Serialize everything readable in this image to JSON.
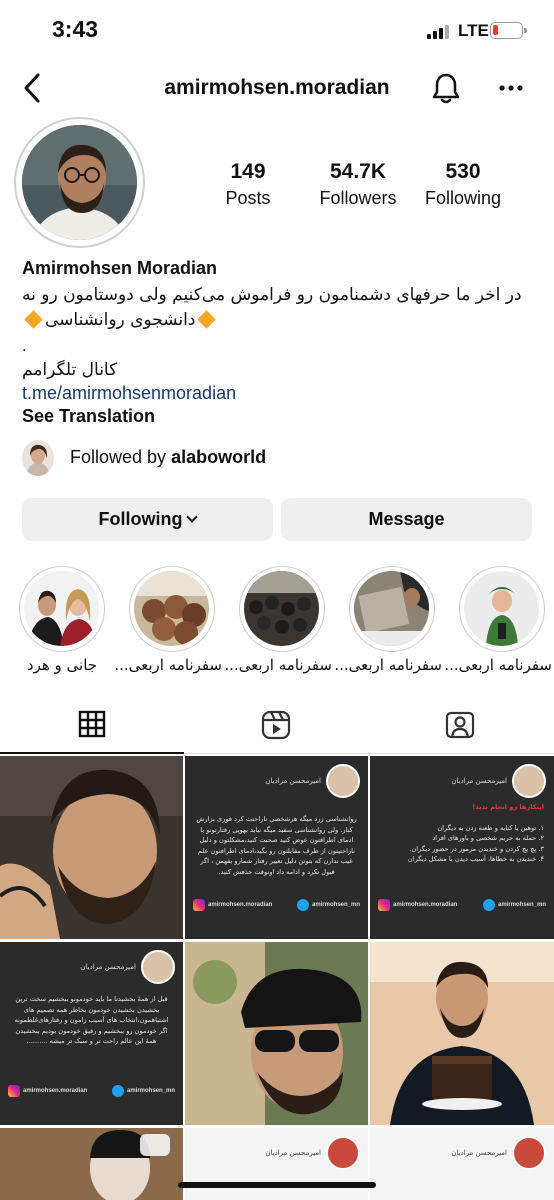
{
  "status_bar": {
    "time": "3:43",
    "network": "LTE"
  },
  "header": {
    "username": "amirmohsen.moradian"
  },
  "profile": {
    "stats": [
      {
        "value": "149",
        "label": "Posts"
      },
      {
        "value": "54.7K",
        "label": "Followers"
      },
      {
        "value": "530",
        "label": "Following"
      }
    ],
    "name": "Amirmohsen Moradian",
    "bio_line1": "در اخر ما حرفهای دشمنامون رو فراموش می‌کنیم ولی دوستامون رو نه",
    "bio_line2": "دانشجوی روانشناسی",
    "bio_line3": ".",
    "bio_line4": "کانال تلگرامم",
    "link": "t.me/amirmohsenmoradian",
    "see_translation": "See Translation",
    "followed_by_prefix": "Followed by",
    "followed_by_user": "alaboworld"
  },
  "actions": {
    "following": "Following",
    "message": "Message"
  },
  "highlights": [
    {
      "label": "جانی و هرد"
    },
    {
      "label": "سفرنامه اربعی..."
    },
    {
      "label": "سفرنامه اربعی..."
    },
    {
      "label": "سفرنامه اربعی..."
    },
    {
      "label": "سفرنامه اربعی..."
    }
  ],
  "tabs": [
    {
      "icon": "grid-icon"
    },
    {
      "icon": "reels-icon"
    },
    {
      "icon": "tagged-icon"
    }
  ],
  "posts": {
    "author_name": "امیرمحسن مرادیان",
    "instagram_handle": "amirmohsen.moradian",
    "twitter_handle": "amirmohsen_mn",
    "post2_text": "روانشناسی زرد میگه هرشخصی ناراحتت کرد فوری بزارش کنار. ولی روانشناسی سفید میگه نباید بهوپی رفتارتونو با ادمای اطرافتون عوض کنید صحبت کنید،مشکلتون و دلیل ناراحتیتون از طرف مقابلتون رو بگید،ادمای اطرافتون علم غیب ندارن که بتونن دلیل تغییر رفتار شمارو بفهمن ، اگر قبول نکرد و ادامه داد اونوقت حذفش کنید.",
    "post3_title": "اینکارها رو انجام ندید!",
    "post3_items": [
      "۱. توهین یا کنایه و طعنه زدن به دیگران",
      "۲. حمله به حریم شخصی و باورهای افراد",
      "۳. پچ پچ کردن و خندیدن مرموز در حضور دیگران.",
      "۴. خندیدن به خطاها، آسیب دیدن یا مشکل دیگران"
    ],
    "post4_text": "قبل از همهٔ بخشیدنا ما باید خودمونو ببخشیم سخت ترین بخشیدن بخشیدن خودمون بخاطر همه تصمیم های اشتباهمون،انتخاب های آسیب زامون و رفتارهای‌غلطمونه اگر خودمون رو ببخشیم و رفیق خودمون بودیم ببخشیدن همهٔ این عالم راحت تر و سبک تر میشه ..........",
    "post3_text_color": "#e03b3b"
  }
}
